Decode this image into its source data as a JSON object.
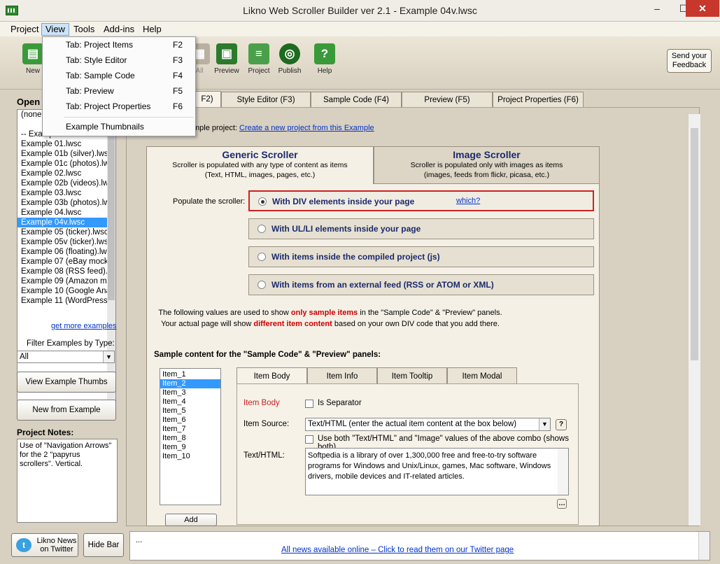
{
  "window": {
    "title": "Likno Web Scroller Builder ver 2.1 - Example 04v.lwsc",
    "minimize": "–",
    "maximize": "☐",
    "close": "✕"
  },
  "menubar": [
    "Project",
    "View",
    "Tools",
    "Add-ins",
    "Help"
  ],
  "toolbar": {
    "new": "New",
    "all": "All",
    "preview": "Preview",
    "project": "Project",
    "publish": "Publish",
    "help": "Help",
    "feedback": "Send your Feedback"
  },
  "view_menu": {
    "items": [
      {
        "label": "Tab: Project Items",
        "key": "F2"
      },
      {
        "label": "Tab: Style Editor",
        "key": "F3"
      },
      {
        "label": "Tab: Sample Code",
        "key": "F4"
      },
      {
        "label": "Tab: Preview",
        "key": "F5"
      },
      {
        "label": "Tab: Project Properties",
        "key": "F6"
      }
    ],
    "extra": "Example Thumbnails"
  },
  "left": {
    "open_label": "Open",
    "examples": [
      "(none",
      "",
      "-- Examples",
      "Example 01.lwsc",
      "Example 01b (silver).lwsc",
      "Example 01c (photos).lw",
      "Example 02.lwsc",
      "Example 02b (videos).lw",
      "Example 03.lwsc",
      "Example 03b (photos).lw",
      "Example 04.lwsc",
      "Example 04v.lwsc",
      "Example 05 (ticker).lwsc",
      "Example 05v (ticker).lwsc",
      "Example 06 (floating).lws",
      "Example 07 (eBay mock",
      "Example 08 (RSS feed).l",
      "Example 09 (Amazon mo",
      "Example 10 (Google Ana",
      "Example 11 (WordPress"
    ],
    "selected_index": 11,
    "get_more": "get more examples",
    "filter_label": "Filter Examples by Type:",
    "filter_value": "All",
    "view_thumbs": "View Example Thumbs",
    "new_from_example": "New from Example",
    "notes_title": "Project Notes:",
    "notes": "Use of \"Navigation Arrows\" for the 2 \"papyrus scrollers\". Vertical."
  },
  "tabs": [
    "F2)",
    "Style Editor   (F3)",
    "Sample Code   (F4)",
    "Preview    (F5)",
    "Project Properties   (F6)"
  ],
  "main": {
    "sample_project_prefix": "mple project:",
    "sample_project_link": "Create a new project from this Example",
    "generic": {
      "title": "Generic Scroller",
      "desc1": "Scroller is populated with any type of content as items",
      "desc2": "(Text, HTML, images, pages, etc.)"
    },
    "image": {
      "title": "Image Scroller",
      "desc1": "Scroller is populated only with images as items",
      "desc2": "(images, feeds from flickr, picasa, etc.)"
    },
    "populate_label": "Populate the scroller:",
    "options": [
      "With DIV elements inside your page",
      "With UL/LI elements inside your page",
      "With items inside the compiled project (js)",
      "With items from an external feed (RSS or ATOM or XML)"
    ],
    "which_link": "which?",
    "info1_a": "The following values are used to show ",
    "info1_b": "only sample items",
    "info1_c": " in the \"Sample Code\" & \"Preview\" panels.",
    "info2_a": "Your actual page will show ",
    "info2_b": "different item content",
    "info2_c": " based on your own DIV code that you add there.",
    "sample_heading": "Sample content for the \"Sample Code\" & \"Preview\" panels:",
    "items": [
      "Item_1",
      "Item_2",
      "Item_3",
      "Item_4",
      "Item_5",
      "Item_6",
      "Item_7",
      "Item_8",
      "Item_9",
      "Item_10"
    ],
    "selected_item": 1,
    "add_button": "Add",
    "prop_tabs": [
      "Item Body",
      "Item Info",
      "Item Tooltip",
      "Item Modal"
    ],
    "item_body_label": "Item Body",
    "is_separator": "Is Separator",
    "item_source_label": "Item Source:",
    "item_source_value": "Text/HTML (enter the actual item content at the box below)",
    "use_both": "Use both \"Text/HTML\" and \"Image\" values of the above combo (shows both)",
    "text_html_label": "Text/HTML:",
    "text_html_value": "Softpedia is a library of over 1,300,000 free and free-to-try software programs for Windows and Unix/Linux, games, Mac software, Windows drivers, mobile devices and IT-related articles."
  },
  "bottom": {
    "news_btn": "Likno News on Twitter",
    "hide_bar": "Hide Bar",
    "ellipsis": "...",
    "news_link": "All news available online – Click to read them on our Twitter page"
  },
  "colors": {
    "accent_red": "#cc0000",
    "selection_blue": "#3399ff",
    "title_blue": "#1a2a6c"
  }
}
